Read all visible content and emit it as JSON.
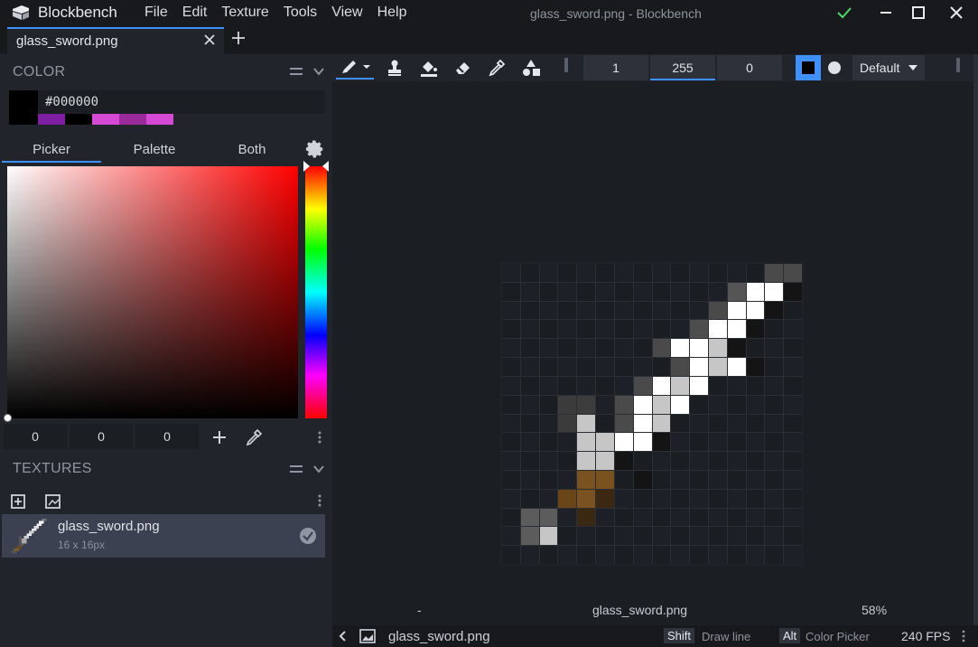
{
  "app": {
    "brand": "Blockbench",
    "window_title": "glass_sword.png - Blockbench",
    "menu": [
      "File",
      "Edit",
      "Texture",
      "Tools",
      "View",
      "Help"
    ]
  },
  "tabs": {
    "items": [
      {
        "label": "glass_sword.png"
      }
    ]
  },
  "color_panel": {
    "title": "COLOR",
    "hex": "#000000",
    "current_color": "#000000",
    "recent_colors": [
      "#7e1fa3",
      "#000000",
      "#d649d6",
      "#9b2a9b",
      "#d649d6"
    ],
    "tabs": [
      "Picker",
      "Palette",
      "Both"
    ],
    "active_tab": "Picker",
    "rgb": [
      "0",
      "0",
      "0"
    ]
  },
  "textures_panel": {
    "title": "TEXTURES",
    "items": [
      {
        "name": "glass_sword.png",
        "size": "16 x 16px"
      }
    ]
  },
  "toolbar": {
    "brush_size": "1",
    "opacity": "255",
    "softness": "0",
    "blend_mode": "Default"
  },
  "canvas": {
    "filename": "glass_sword.png",
    "left_label": "-",
    "zoom": "58%"
  },
  "statusbar": {
    "filename": "glass_sword.png",
    "shortcut1_key": "Shift",
    "shortcut1_label": "Draw line",
    "shortcut2_key": "Alt",
    "shortcut2_label": "Color Picker",
    "fps": "240 FPS"
  },
  "colors": {
    "accent": "#3e90ff",
    "titlebar": "#17191d",
    "panel": "#21252b",
    "canvas": "#1b1e23"
  },
  "sword_pixels": [
    "................",
    "..............ddD",
    "............gWWk",
    "...........dWWk.",
    "..........mWWk..",
    "........dWWLk...",
    ".........dWLWk..",
    ".......dWLW.....",
    "...DD.dWLW......",
    "...DL.dWL.......",
    "....LLWWk.......",
    "....LLk.........",
    "....bb.k........",
    "...obB..........",
    ".GG.B...........",
    ".GL.............",
    "................"
  ]
}
